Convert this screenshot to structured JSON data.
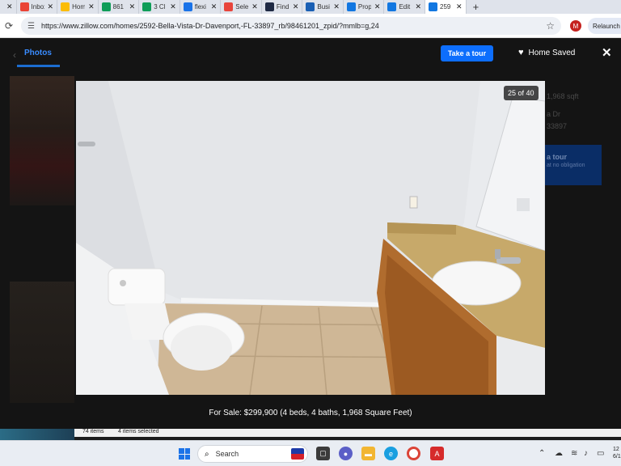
{
  "browser": {
    "tabs": [
      {
        "title": "",
        "icon": "close-only",
        "color": "#dfe3eb"
      },
      {
        "title": "Inbox",
        "icon": "gmail-icon",
        "color": "#ea4335"
      },
      {
        "title": "Hom",
        "icon": "drive-icon",
        "color": "#fbbc04"
      },
      {
        "title": "861",
        "icon": "sheets-icon",
        "color": "#0f9d58"
      },
      {
        "title": "3 Cl",
        "icon": "sheets-icon",
        "color": "#0f9d58"
      },
      {
        "title": "flexi",
        "icon": "circle-icon",
        "color": "#1a73e8"
      },
      {
        "title": "Sele",
        "icon": "diamond-icon",
        "color": "#e8453c"
      },
      {
        "title": "Find",
        "icon": "crest-icon",
        "color": "#1f2a44"
      },
      {
        "title": "Busi",
        "icon": "chase-icon",
        "color": "#1a5fb4"
      },
      {
        "title": "Prop",
        "icon": "zillow-icon",
        "color": "#1277e1"
      },
      {
        "title": "Edit",
        "icon": "zillow-icon",
        "color": "#1277e1"
      },
      {
        "title": "259",
        "icon": "zillow-icon",
        "color": "#1277e1",
        "active": true
      }
    ],
    "new_tab": "+",
    "url": "https://www.zillow.com/homes/2592-Bella-Vista-Dr-Davenport,-FL-33897_rb/98461201_zpid/?mmlb=g,24",
    "profile_initial": "M",
    "relaunch_label": "Relaunch t"
  },
  "background": {
    "sqft": "1,968 sqft",
    "addr1": "a Dr",
    "addr2": "33897",
    "tour_partial": "a tour",
    "tour_sub": "at no obligation"
  },
  "modal": {
    "tab_label": "Photos",
    "tour_button": "Take a tour",
    "saved_label": "Home Saved",
    "close": "✕",
    "counter": "25 of 40",
    "caption": "For Sale: $299,900 (4 beds, 4 baths, 1,968 Square Feet)"
  },
  "explorer": {
    "items": "74 items",
    "selected": "4 items selected"
  },
  "taskbar": {
    "search_label": "Search",
    "clock": "12\n6/1"
  },
  "colors": {
    "accent": "#0d6efd",
    "photos_tab": "#3a8cff",
    "overlay": "#141414"
  }
}
